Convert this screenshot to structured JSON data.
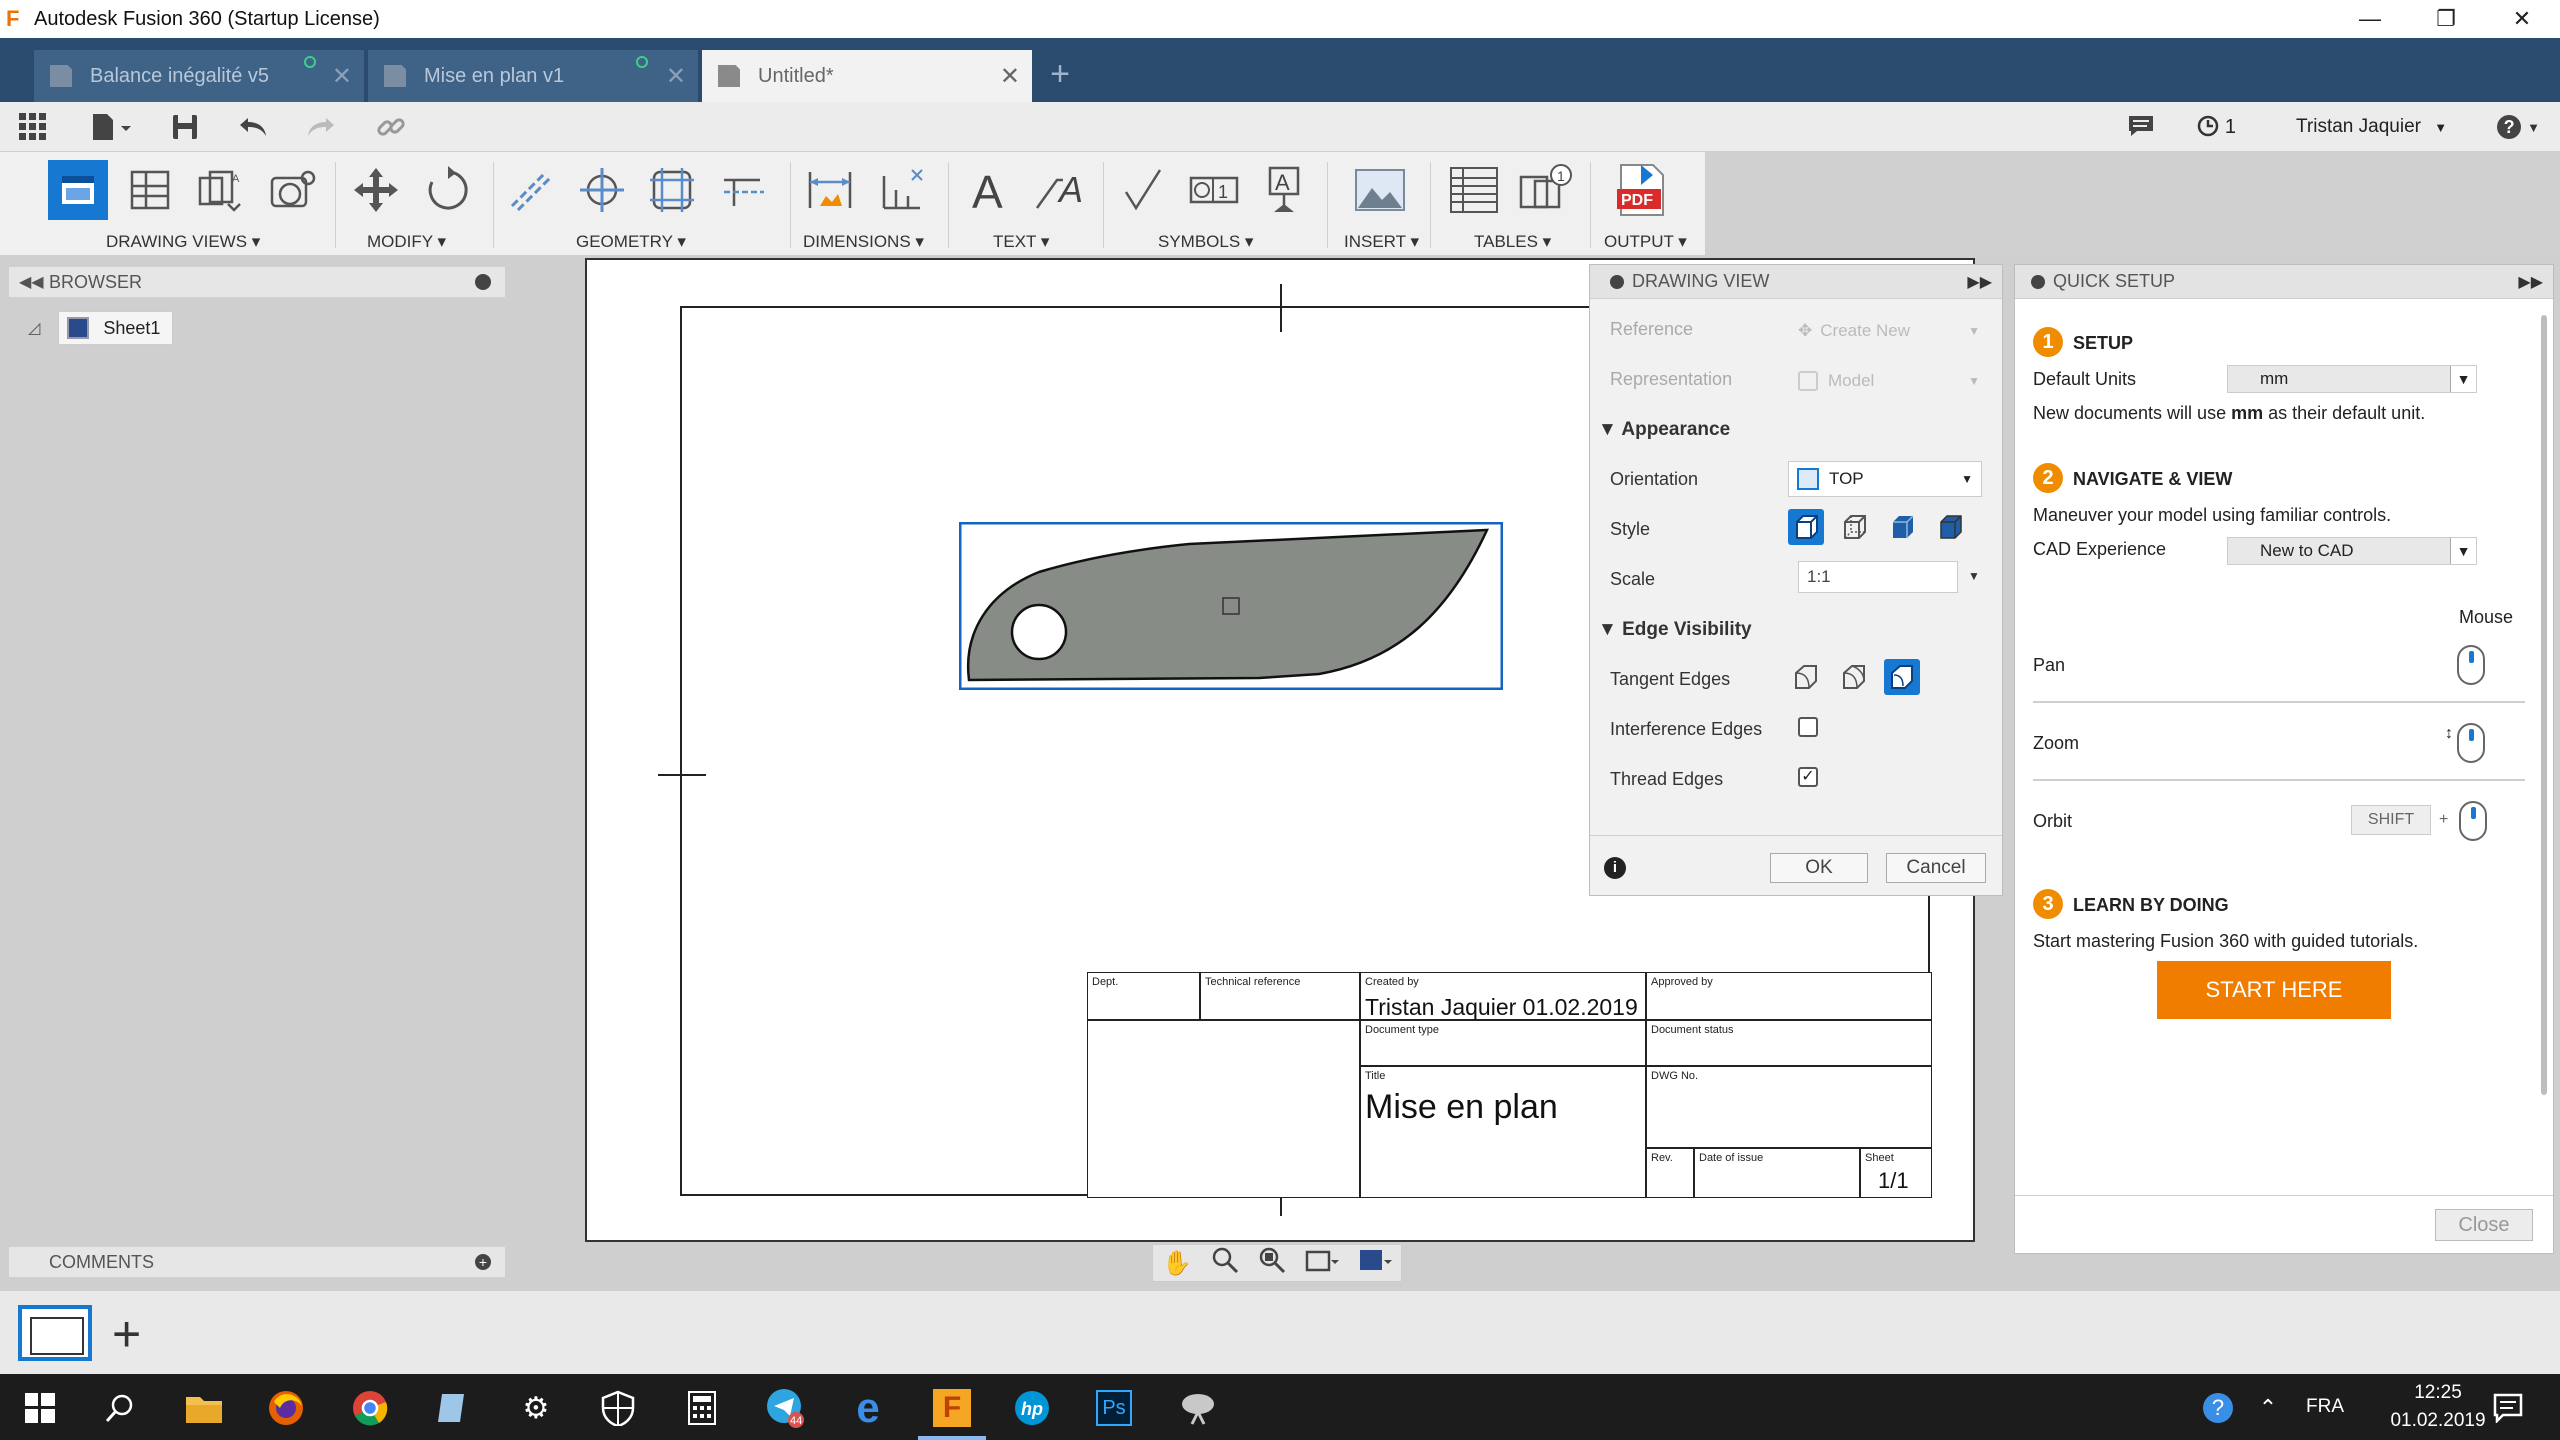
{
  "window": {
    "title": "Autodesk Fusion 360 (Startup License)",
    "logo": "F",
    "controls": {
      "minimize": "—",
      "restore": "❐",
      "close": "✕"
    }
  },
  "tabs": [
    {
      "label": "Balance inégalité v5",
      "close": "✕"
    },
    {
      "label": "Mise en plan v1",
      "close": "✕"
    },
    {
      "label": "Untitled*",
      "close": "✕"
    }
  ],
  "new_tab": "+",
  "quickbar": {
    "jobs_count": "1",
    "user": "Tristan Jaquier",
    "help": "?"
  },
  "ribbon": {
    "groups": [
      {
        "label": "DRAWING VIEWS ▾"
      },
      {
        "label": "MODIFY ▾"
      },
      {
        "label": "GEOMETRY ▾"
      },
      {
        "label": "DIMENSIONS ▾"
      },
      {
        "label": "TEXT ▾"
      },
      {
        "label": "SYMBOLS ▾"
      },
      {
        "label": "INSERT ▾"
      },
      {
        "label": "TABLES ▾"
      },
      {
        "label": "OUTPUT ▾"
      }
    ],
    "pdf_label": "PDF"
  },
  "browser": {
    "title": "BROWSER",
    "sheet": "Sheet1"
  },
  "comments": {
    "title": "COMMENTS"
  },
  "title_block": {
    "dept": "Dept.",
    "technical_reference": "Technical reference",
    "created_by_label": "Created by",
    "created_by": "Tristan Jaquier 01.02.2019",
    "approved_by_label": "Approved by",
    "document_type_label": "Document type",
    "document_status_label": "Document status",
    "title_label": "Title",
    "title": "Mise en plan",
    "dwg_no_label": "DWG No.",
    "rev_label": "Rev.",
    "date_of_issue_label": "Date of issue",
    "sheet_label": "Sheet",
    "sheet": "1/1"
  },
  "drawing_view": {
    "title": "DRAWING VIEW",
    "reference_label": "Reference",
    "reference_value": "Create New",
    "representation_label": "Representation",
    "representation_value": "Model",
    "appearance_label": "▼ Appearance",
    "orientation_label": "Orientation",
    "orientation_value": "TOP",
    "style_label": "Style",
    "scale_label": "Scale",
    "scale_value": "1:1",
    "edge_visibility_label": "▼ Edge Visibility",
    "tangent_edges_label": "Tangent Edges",
    "interference_edges_label": "Interference Edges",
    "interference_edges_checked": false,
    "thread_edges_label": "Thread Edges",
    "thread_edges_checked": true,
    "ok": "OK",
    "cancel": "Cancel"
  },
  "quick_setup": {
    "title": "QUICK SETUP",
    "step1_num": "1",
    "step1_title": "SETUP",
    "default_units_label": "Default Units",
    "default_units_value": "mm",
    "units_note_prefix": "New documents will use ",
    "units_note_unit": "mm",
    "units_note_suffix": " as their default unit.",
    "step2_num": "2",
    "step2_title": "NAVIGATE & VIEW",
    "step2_desc": "Maneuver your model using familiar controls.",
    "cad_experience_label": "CAD Experience",
    "cad_experience_value": "New to CAD",
    "mouse_label": "Mouse",
    "pan_label": "Pan",
    "zoom_label": "Zoom",
    "orbit_label": "Orbit",
    "orbit_key": "SHIFT",
    "orbit_plus": "+",
    "step3_num": "3",
    "step3_title": "LEARN BY DOING",
    "step3_desc": "Start mastering Fusion 360 with guided tutorials.",
    "start_here": "START HERE",
    "close": "Close"
  },
  "taskbar": {
    "language": "FRA",
    "time": "12:25",
    "date": "01.02.2019",
    "telegram_badge": "44",
    "photoshop": "Ps"
  },
  "colors": {
    "accent_blue": "#1778d2",
    "orange": "#f07d00",
    "tab_bar": "#2a4a6e"
  }
}
